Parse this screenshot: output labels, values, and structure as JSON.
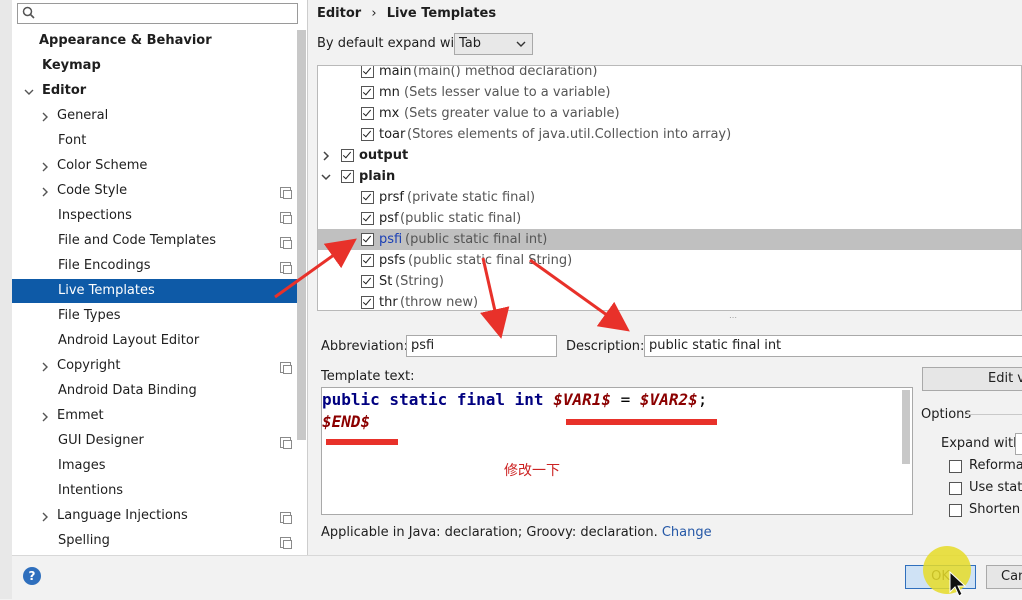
{
  "sidebar": {
    "search": {
      "placeholder": "",
      "value": ""
    },
    "items": [
      {
        "label": "Appearance & Behavior"
      },
      {
        "label": "Keymap"
      },
      {
        "label": "Editor"
      },
      {
        "label": "General"
      },
      {
        "label": "Font"
      },
      {
        "label": "Color Scheme"
      },
      {
        "label": "Code Style"
      },
      {
        "label": "Inspections"
      },
      {
        "label": "File and Code Templates"
      },
      {
        "label": "File Encodings"
      },
      {
        "label": "Live Templates"
      },
      {
        "label": "File Types"
      },
      {
        "label": "Android Layout Editor"
      },
      {
        "label": "Copyright"
      },
      {
        "label": "Android Data Binding"
      },
      {
        "label": "Emmet"
      },
      {
        "label": "GUI Designer"
      },
      {
        "label": "Images"
      },
      {
        "label": "Intentions"
      },
      {
        "label": "Language Injections"
      },
      {
        "label": "Spelling"
      }
    ]
  },
  "header": {
    "crumb1": "Editor",
    "sep": "›",
    "crumb2": "Live Templates"
  },
  "expand": {
    "label": "By default expand with",
    "value": "Tab"
  },
  "templates": [
    {
      "abbr": "main",
      "desc": "(main() method declaration)"
    },
    {
      "abbr": "mn",
      "desc": "(Sets lesser value to a variable)"
    },
    {
      "abbr": "mx",
      "desc": "(Sets greater value to a variable)"
    },
    {
      "abbr": "toar",
      "desc": "(Stores elements of java.util.Collection into array)"
    },
    {
      "group": "output"
    },
    {
      "group": "plain"
    },
    {
      "abbr": "prsf",
      "desc": "(private static final)"
    },
    {
      "abbr": "psf",
      "desc": "(public static final)"
    },
    {
      "abbr": "psfi",
      "desc": "(public static final int)"
    },
    {
      "abbr": "psfs",
      "desc": "(public static final String)"
    },
    {
      "abbr": "St",
      "desc": "(String)"
    },
    {
      "abbr": "thr",
      "desc": "(throw new)"
    }
  ],
  "form": {
    "abbr_label": "Abbreviation:",
    "abbr_value": "psfi",
    "desc_label": "Description:",
    "desc_value": "public static final int",
    "template_label": "Template text:",
    "code_kw": "public static final int",
    "code_var1": "$VAR1$",
    "code_eq": "=",
    "code_var2": "$VAR2$",
    "code_semi": ";",
    "code_end": "$END$",
    "annotation": "修改一下",
    "applicable": "Applicable in Java: declaration; Groovy: declaration.",
    "change_link": "Change"
  },
  "options": {
    "edit_vars": "Edit va",
    "title": "Options",
    "expand_with": "Expand with",
    "reformat": "Reformat",
    "use_static": "Use static",
    "shorten": "Shorten F"
  },
  "buttons": {
    "ok": "OK",
    "cancel": "Canc",
    "help": "?"
  },
  "colors": {
    "selection": "#0e5aa7",
    "arrow": "#e8312a",
    "highlight": "#e6dc28"
  }
}
